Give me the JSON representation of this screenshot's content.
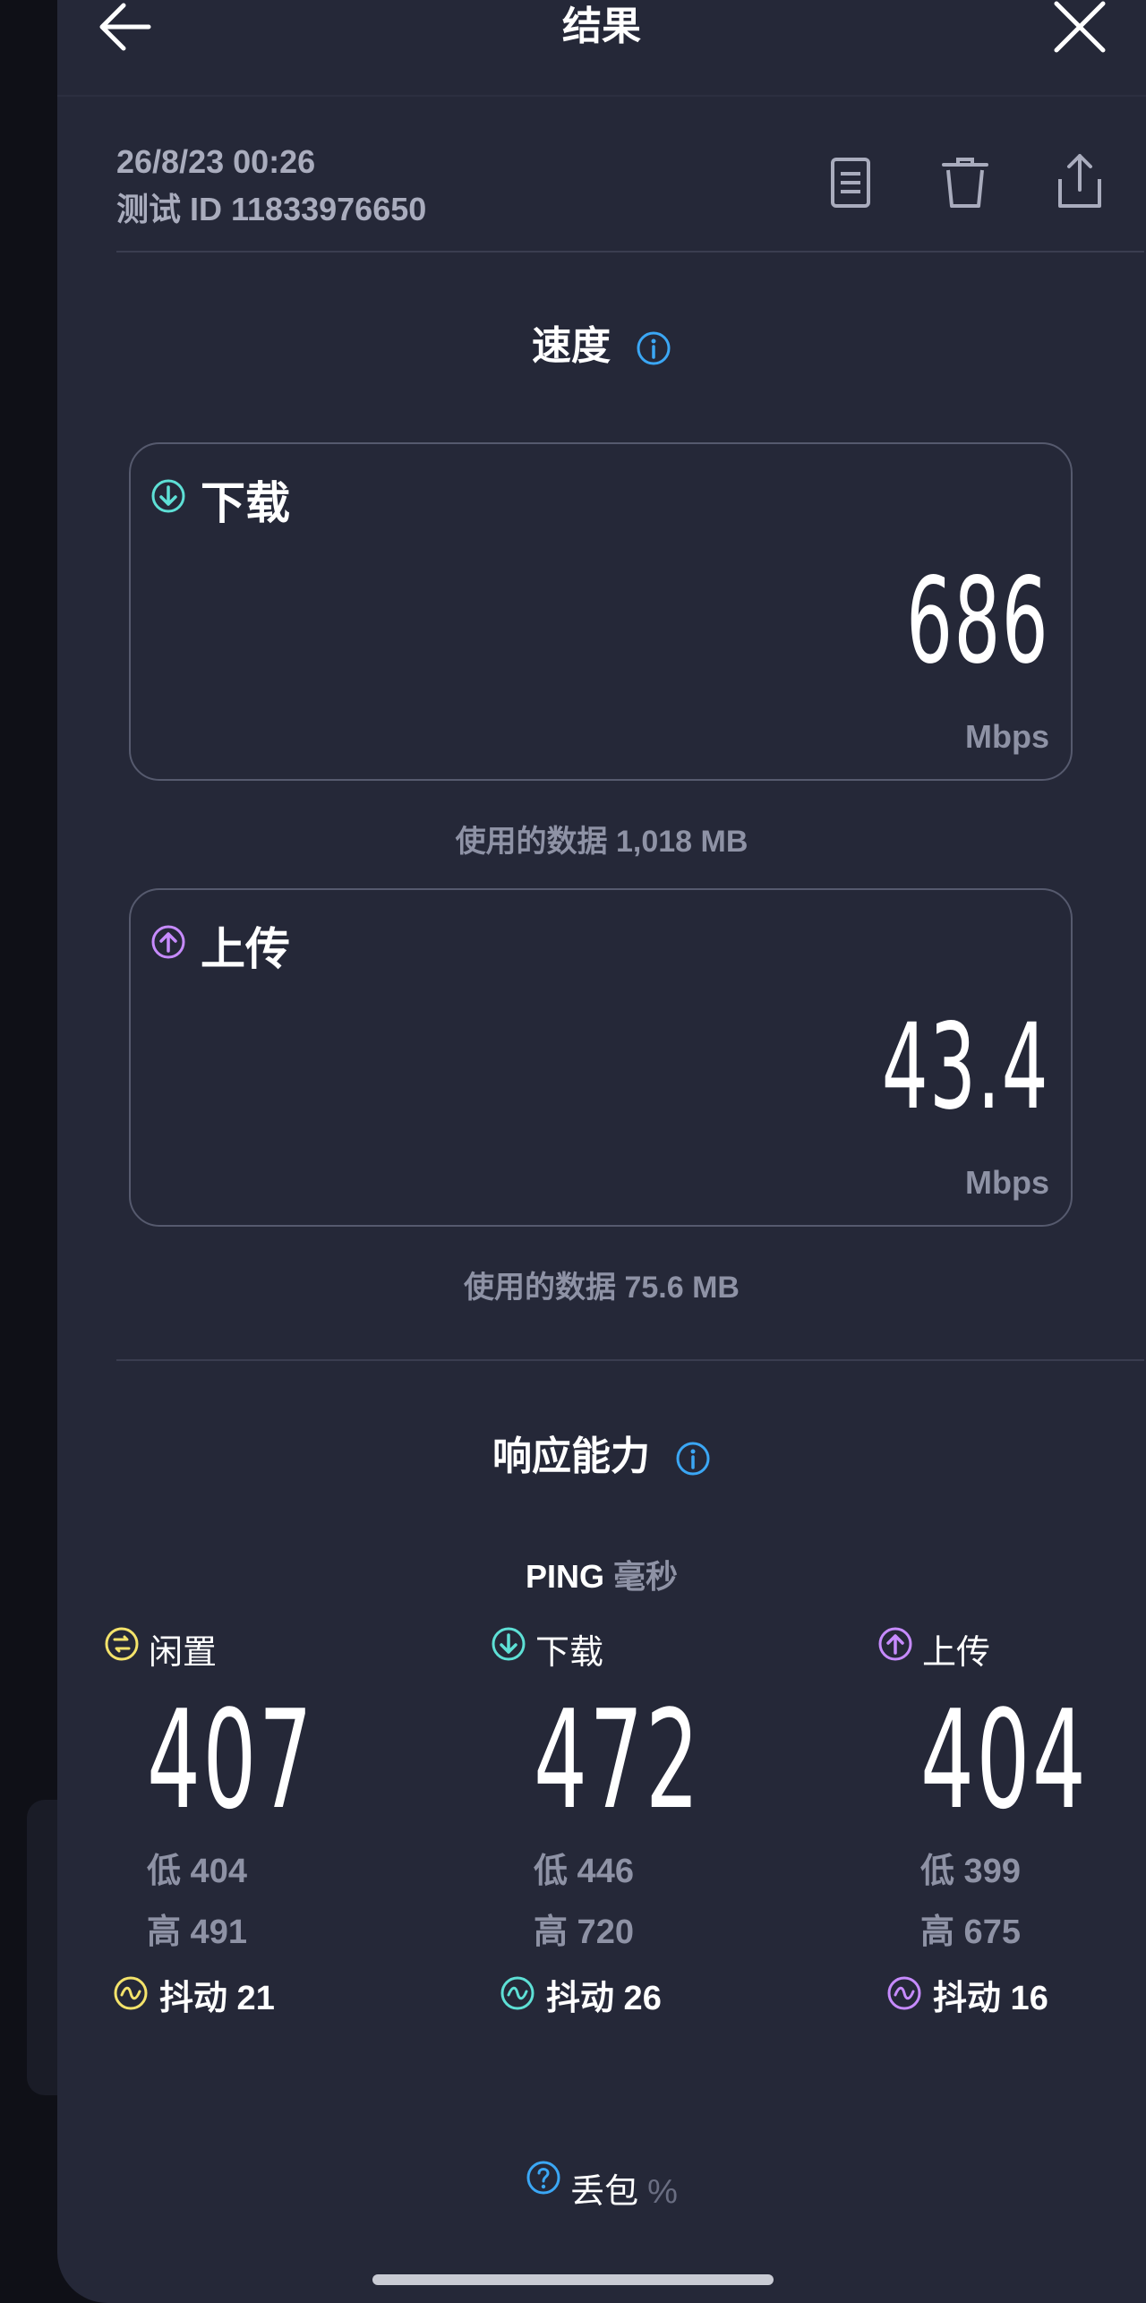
{
  "header": {
    "title": "结果",
    "back_icon": "arrow-left-icon",
    "close_icon": "close-icon"
  },
  "meta": {
    "date": "26/8/23 00:26",
    "test_id": "测试 ID 11833976650",
    "tools": [
      "document-icon",
      "trash-icon",
      "share-icon"
    ]
  },
  "speed": {
    "title": "速度",
    "download": {
      "label": "下载",
      "value": "686",
      "unit": "Mbps",
      "data_used": "使用的数据 1,018 MB",
      "color": "#5ee0d6"
    },
    "upload": {
      "label": "上传",
      "value": "43.4",
      "unit": "Mbps",
      "data_used": "使用的数据 75.6 MB",
      "color": "#c78bff"
    }
  },
  "responsiveness": {
    "title": "响应能力",
    "ping_label": "PING",
    "ping_unit": "毫秒",
    "columns": [
      {
        "label": "闲置",
        "value": "407",
        "low": "低 404",
        "high": "高 491",
        "jitter": "抖动 21",
        "color": "#f4e36b"
      },
      {
        "label": "下载",
        "value": "472",
        "low": "低 446",
        "high": "高 720",
        "jitter": "抖动 26",
        "color": "#5ee0d6"
      },
      {
        "label": "上传",
        "value": "404",
        "low": "低 399",
        "high": "高 675",
        "jitter": "抖动 16",
        "color": "#c78bff"
      }
    ],
    "packet_loss_label": "丢包",
    "packet_loss_value": "%"
  },
  "colors": {
    "background": "#252838",
    "info": "#3ba7f5"
  }
}
